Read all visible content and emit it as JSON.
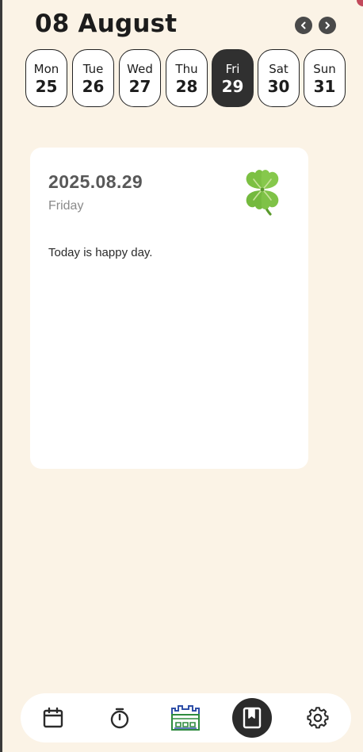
{
  "header": {
    "title": "08 August",
    "prev_icon": "chevron-left-icon",
    "next_icon": "chevron-right-icon"
  },
  "week": {
    "days": [
      {
        "name": "Mon",
        "num": "25",
        "selected": false
      },
      {
        "name": "Tue",
        "num": "26",
        "selected": false
      },
      {
        "name": "Wed",
        "num": "27",
        "selected": false
      },
      {
        "name": "Thu",
        "num": "28",
        "selected": false
      },
      {
        "name": "Fri",
        "num": "29",
        "selected": true
      },
      {
        "name": "Sat",
        "num": "30",
        "selected": false
      },
      {
        "name": "Sun",
        "num": "31",
        "selected": false
      }
    ]
  },
  "entry": {
    "date": "2025.08.29",
    "weekday": "Friday",
    "text": "Today is happy day.",
    "mood_icon": "four-leaf-clover-icon"
  },
  "bottom_nav": {
    "tabs": [
      {
        "icon": "calendar-icon",
        "active": false
      },
      {
        "icon": "timer-icon",
        "active": false
      },
      {
        "icon": "castle-icon",
        "active": false
      },
      {
        "icon": "bookmark-book-icon",
        "active": true
      },
      {
        "icon": "gear-icon",
        "active": false
      }
    ]
  },
  "colors": {
    "background": "#FBF3E6",
    "card": "#FFFFFF",
    "selected_day": "#303030",
    "text_dark": "#1C1C1C",
    "text_grey": "#585858",
    "castle_blue": "#2F4FA8",
    "castle_green": "#2E8B3E"
  }
}
